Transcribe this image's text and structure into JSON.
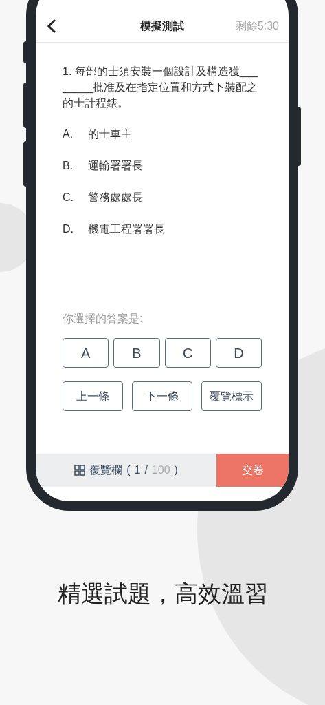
{
  "header": {
    "title": "模擬測試",
    "timer": "剩餘5:30"
  },
  "question": "1. 每部的士須安裝一個設計及構造獲________批准及在指定位置和方式下裝配之的士計程錶。",
  "options": [
    {
      "letter": "A.",
      "text": "的士車主"
    },
    {
      "letter": "B.",
      "text": "運輸署署長"
    },
    {
      "letter": "C.",
      "text": "警務處處長"
    },
    {
      "letter": "D.",
      "text": "機電工程署署長"
    }
  ],
  "answer_prompt": "你選擇的答案是:",
  "answer_buttons": [
    {
      "label": "A",
      "selected": false
    },
    {
      "label": "B",
      "selected": false
    },
    {
      "label": "C",
      "selected": false
    },
    {
      "label": "D",
      "selected": false
    }
  ],
  "nav_buttons": [
    "上一條",
    "下一條",
    "覆覽標示"
  ],
  "bottom_bar": {
    "overview_label": "覆覽欄",
    "open": "(",
    "current": "1",
    "separator": "/",
    "total": "100",
    "close": ")",
    "submit": "交卷"
  },
  "tagline": "精選試題，高效溫習"
}
